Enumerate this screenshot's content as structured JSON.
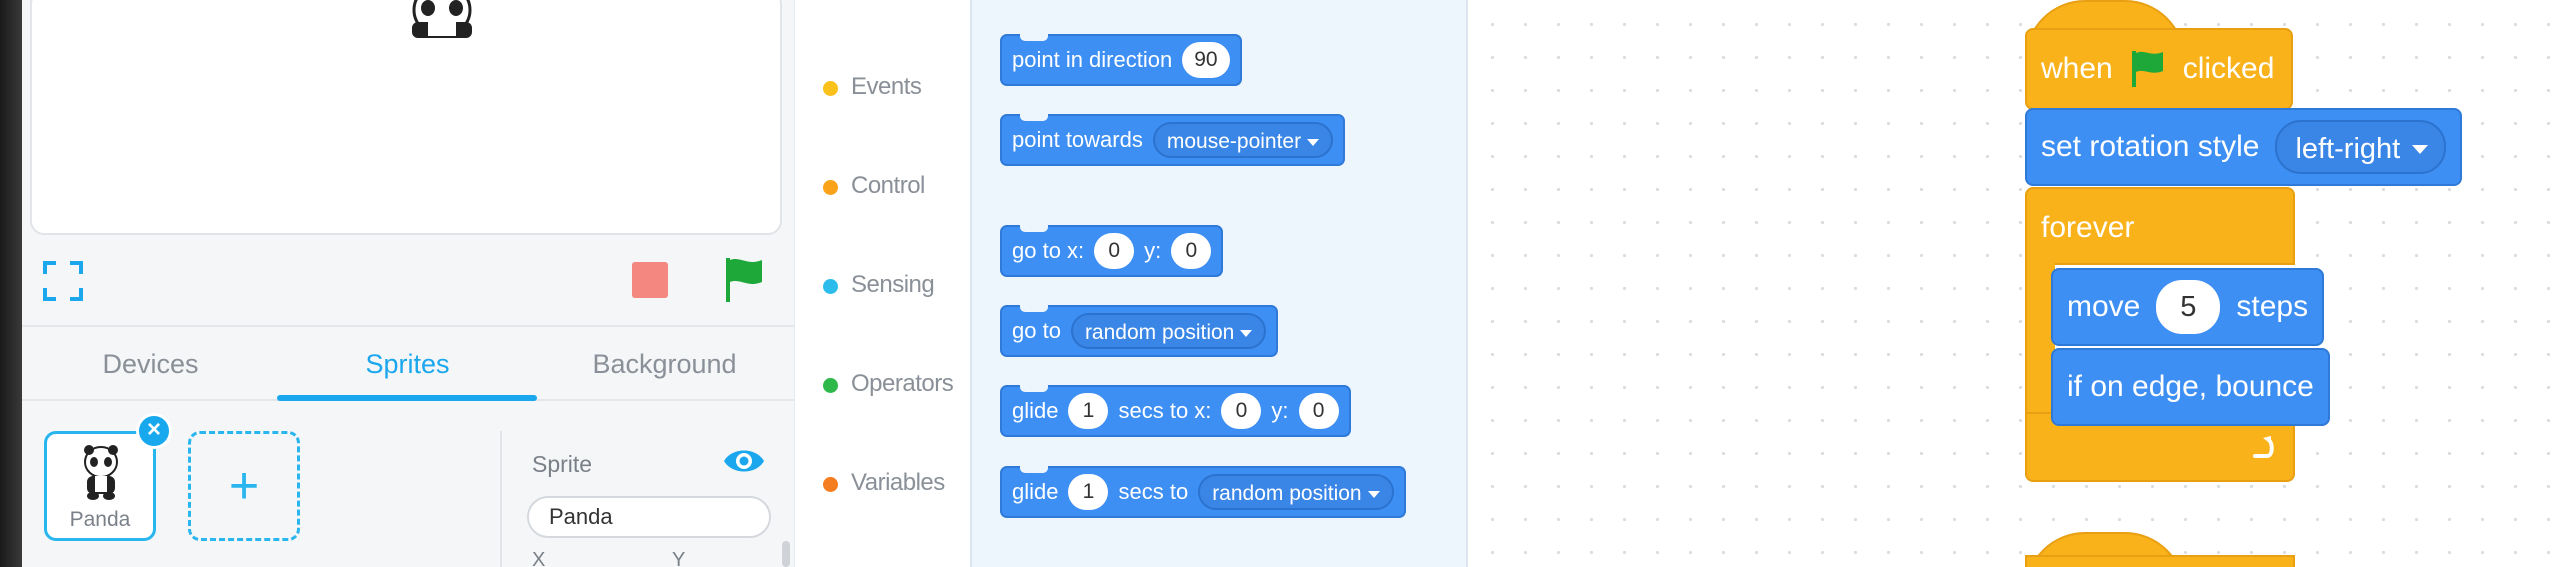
{
  "stage": {
    "controls": {
      "fullscreen_icon": "fullscreen-icon",
      "stop_icon": "stop-icon",
      "go_icon": "green-flag-icon"
    }
  },
  "tabs": [
    {
      "label": "Devices",
      "active": false
    },
    {
      "label": "Sprites",
      "active": true
    },
    {
      "label": "Background",
      "active": false
    }
  ],
  "sprites": {
    "items": [
      {
        "name": "Panda",
        "selected": true
      }
    ],
    "add_symbol": "+",
    "delete_symbol": "×",
    "properties": {
      "sprite_label": "Sprite",
      "name_value": "Panda",
      "x_label": "X",
      "y_label": "Y"
    }
  },
  "categories": [
    {
      "label": "Events",
      "color": "#f9c11a"
    },
    {
      "label": "Control",
      "color": "#f9a21a"
    },
    {
      "label": "Sensing",
      "color": "#2cbcec"
    },
    {
      "label": "Operators",
      "color": "#2eb84a"
    },
    {
      "label": "Variables",
      "color": "#f57c1f"
    }
  ],
  "palette": {
    "point_in_direction": {
      "text": "point in direction",
      "value": "90"
    },
    "point_towards": {
      "text": "point towards",
      "option": "mouse-pointer"
    },
    "go_to_xy": {
      "text": "go to x:",
      "x": "0",
      "y_label": "y:",
      "y": "0"
    },
    "go_to": {
      "text": "go to",
      "option": "random position"
    },
    "glide_xy": {
      "text": "glide",
      "secs": "1",
      "text2": "secs to x:",
      "x": "0",
      "y_label": "y:",
      "y": "0"
    },
    "glide_to": {
      "text": "glide",
      "secs": "1",
      "text2": "secs to",
      "option": "random position"
    }
  },
  "script": {
    "when_flag": {
      "text1": "when",
      "text2": "clicked"
    },
    "rotation": {
      "text": "set rotation style",
      "option": "left-right"
    },
    "forever": {
      "text": "forever"
    },
    "move": {
      "text1": "move",
      "value": "5",
      "text2": "steps"
    },
    "bounce": {
      "text": "if on edge, bounce"
    }
  },
  "colors": {
    "accent": "#1aa7ee",
    "motion_block": "#3d8ff3",
    "event_block": "#f9b21a",
    "stop": "#f48880",
    "go": "#1fa83a"
  }
}
